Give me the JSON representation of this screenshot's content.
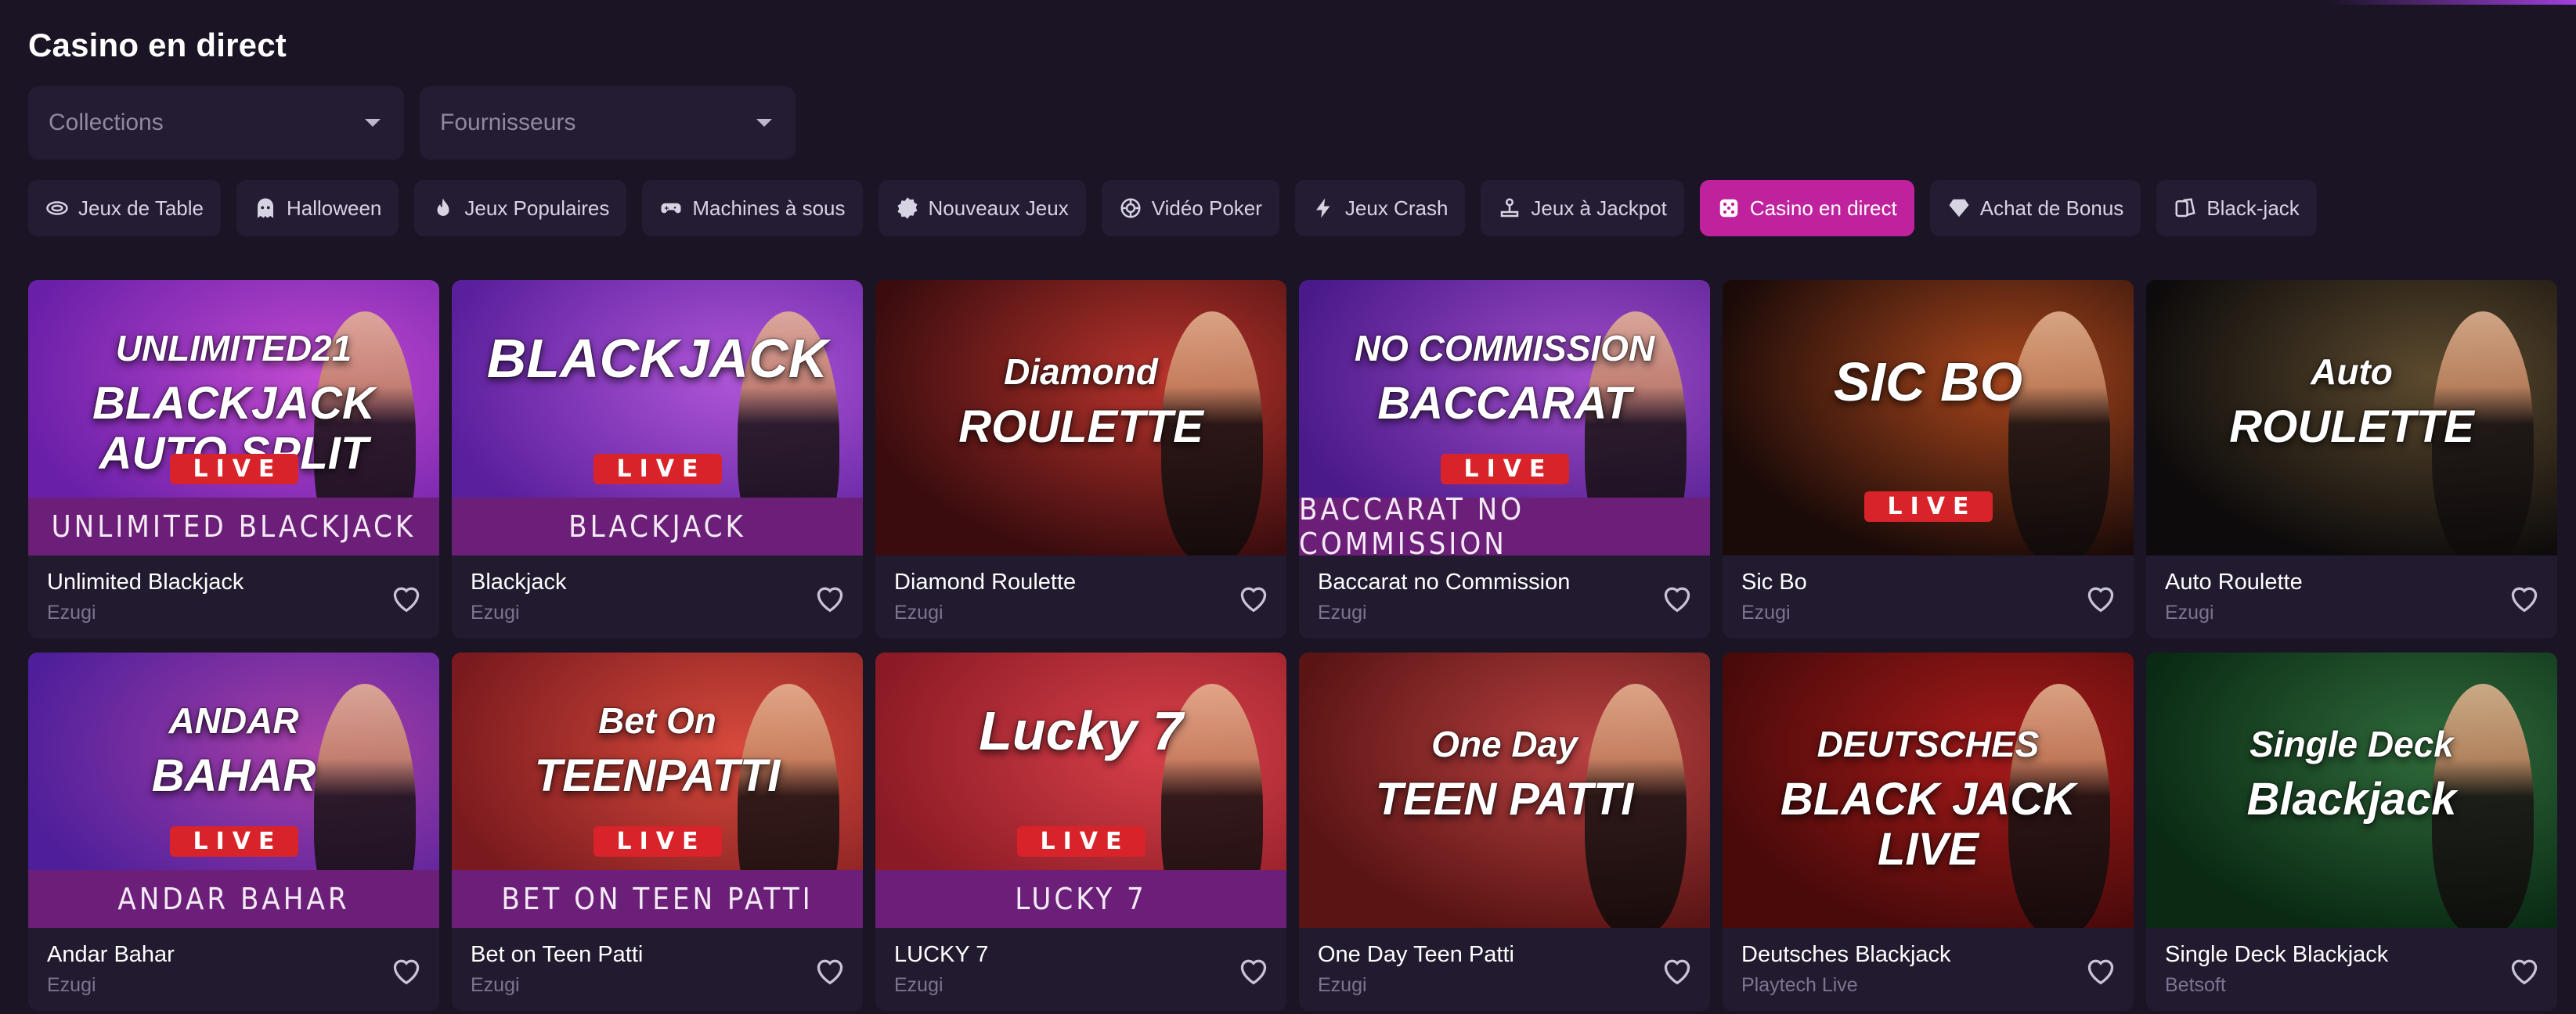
{
  "page": {
    "title": "Casino en direct"
  },
  "filters": [
    {
      "label": "Collections"
    },
    {
      "label": "Fournisseurs"
    }
  ],
  "categories": [
    {
      "label": "Jeux de Table",
      "icon": "table-games-icon",
      "active": false
    },
    {
      "label": "Halloween",
      "icon": "ghost-icon",
      "active": false
    },
    {
      "label": "Jeux Populaires",
      "icon": "flame-icon",
      "active": false
    },
    {
      "label": "Machines à sous",
      "icon": "gamepad-icon",
      "active": false
    },
    {
      "label": "Nouveaux Jeux",
      "icon": "new-badge-icon",
      "active": false
    },
    {
      "label": "Vidéo Poker",
      "icon": "poker-chip-icon",
      "active": false
    },
    {
      "label": "Jeux Crash",
      "icon": "lightning-icon",
      "active": false
    },
    {
      "label": "Jeux à Jackpot",
      "icon": "joystick-icon",
      "active": false
    },
    {
      "label": "Casino en direct",
      "icon": "dice-icon",
      "active": true
    },
    {
      "label": "Achat de Bonus",
      "icon": "diamond-icon",
      "active": false
    },
    {
      "label": "Black-jack",
      "icon": "cards-icon",
      "active": false
    }
  ],
  "games": [
    {
      "name": "Unlimited Blackjack",
      "provider": "Ezugi",
      "banner": "UNLIMITED BLACKJACK",
      "art_lines": [
        "UNLIMITED21",
        "BLACKJACK",
        "AUTO SPLIT"
      ],
      "live": "LIVE",
      "colors": [
        "#6a1fa8",
        "#c04ad0"
      ]
    },
    {
      "name": "Blackjack",
      "provider": "Ezugi",
      "banner": "BLACKJACK",
      "art_lines": [
        "BLACKJACK"
      ],
      "live": "LIVE",
      "colors": [
        "#5a1f9c",
        "#b056d8"
      ]
    },
    {
      "name": "Diamond Roulette",
      "provider": "Ezugi",
      "banner": "",
      "art_lines": [
        "Diamond",
        "ROULETTE"
      ],
      "live": "",
      "colors": [
        "#3a0c0e",
        "#b8332c"
      ]
    },
    {
      "name": "Baccarat no Commission",
      "provider": "Ezugi",
      "banner": "BACCARAT NO COMMISSION",
      "art_lines": [
        "NO COMMISSION",
        "BACCARAT"
      ],
      "live": "LIVE",
      "colors": [
        "#4a1a8a",
        "#a04cc8"
      ]
    },
    {
      "name": "Sic Bo",
      "provider": "Ezugi",
      "banner": "",
      "art_lines": [
        "SIC BO"
      ],
      "live": "LIVE",
      "colors": [
        "#1a0a08",
        "#a8461c"
      ]
    },
    {
      "name": "Auto Roulette",
      "provider": "Ezugi",
      "banner": "",
      "art_lines": [
        "Auto",
        "ROULETTE"
      ],
      "live": "",
      "colors": [
        "#0d0b0b",
        "#5c4a2e"
      ]
    },
    {
      "name": "Andar Bahar",
      "provider": "Ezugi",
      "banner": "ANDAR BAHAR",
      "art_lines": [
        "ANDAR",
        "BAHAR"
      ],
      "live": "LIVE",
      "colors": [
        "#4e1f9a",
        "#a840a8"
      ]
    },
    {
      "name": "Bet on Teen Patti",
      "provider": "Ezugi",
      "banner": "BET ON TEEN PATTI",
      "art_lines": [
        "Bet On",
        "TEENPATTI"
      ],
      "live": "LIVE",
      "colors": [
        "#7a1a1e",
        "#d84a3c"
      ]
    },
    {
      "name": "LUCKY 7",
      "provider": "Ezugi",
      "banner": "LUCKY 7",
      "art_lines": [
        "Lucky 7"
      ],
      "live": "LIVE",
      "colors": [
        "#8a1a24",
        "#d8404a"
      ]
    },
    {
      "name": "One Day Teen Patti",
      "provider": "Ezugi",
      "banner": "",
      "art_lines": [
        "One Day",
        "TEEN PATTI"
      ],
      "live": "",
      "colors": [
        "#5a1414",
        "#b84040"
      ]
    },
    {
      "name": "Deutsches Blackjack",
      "provider": "Playtech Live",
      "banner": "",
      "art_lines": [
        "DEUTSCHES",
        "BLACK JACK",
        "LIVE"
      ],
      "live": "",
      "colors": [
        "#4a0a0a",
        "#a81a1a"
      ]
    },
    {
      "name": "Single Deck Blackjack",
      "provider": "Betsoft",
      "banner": "",
      "art_lines": [
        "Single Deck",
        "Blackjack"
      ],
      "live": "",
      "colors": [
        "#0a2a14",
        "#2f6a3a"
      ]
    }
  ]
}
